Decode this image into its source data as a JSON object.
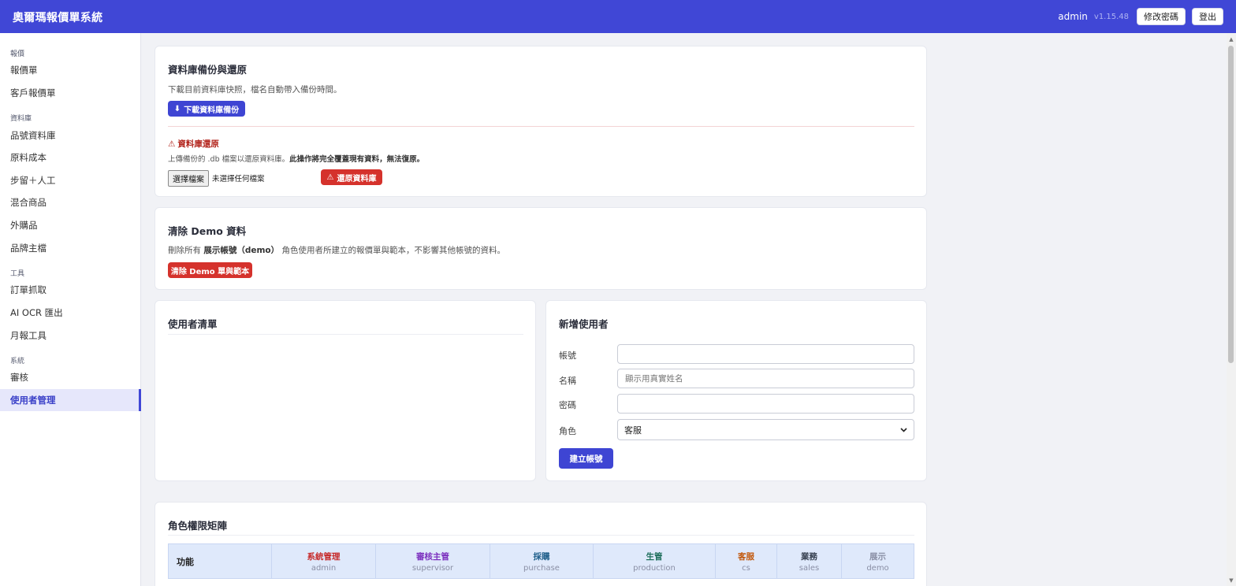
{
  "header": {
    "title": "奧爾瑪報價單系統",
    "user": "admin",
    "version": "v1.15.48",
    "change_password": "修改密碼",
    "logout": "登出"
  },
  "sidebar": {
    "sections": [
      {
        "label": "報價"
      },
      {
        "label": "資料庫"
      },
      {
        "label": "工具"
      },
      {
        "label": "系統"
      }
    ],
    "items": [
      {
        "label": "報價單"
      },
      {
        "label": "客戶報價單"
      },
      {
        "label": "品號資料庫"
      },
      {
        "label": "原料成本"
      },
      {
        "label": "步留＋人工"
      },
      {
        "label": "混合商品"
      },
      {
        "label": "外購品"
      },
      {
        "label": "品牌主檔"
      },
      {
        "label": "訂單抓取"
      },
      {
        "label": "AI OCR 匯出"
      },
      {
        "label": "月報工具"
      },
      {
        "label": "審核"
      },
      {
        "label": "使用者管理",
        "active": true
      }
    ]
  },
  "backup": {
    "title": "資料庫備份與還原",
    "description": "下載目前資料庫快照，檔名自動帶入備份時間。",
    "download_button": "下載資料庫備份",
    "restore_title": "資料庫還原",
    "restore_desc_prefix": "上傳備份的 .db 檔案以還原資料庫。",
    "restore_desc_warning": "此操作將完全覆蓋現有資料，無法復原。",
    "choose_file": "選擇檔案",
    "no_file": "未選擇任何檔案",
    "restore_button": "還原資料庫"
  },
  "demo": {
    "title": "清除 Demo 資料",
    "desc_prefix": "刪除所有",
    "desc_bold": "展示帳號（demo）",
    "desc_suffix": "角色使用者所建立的報價單與範本，不影響其他帳號的資料。",
    "button": "清除 Demo 單與範本"
  },
  "users": {
    "title": "使用者清單"
  },
  "new_user": {
    "title": "新增使用者",
    "account_label": "帳號",
    "name_label": "名稱",
    "name_placeholder": "顯示用真實姓名",
    "password_label": "密碼",
    "role_label": "角色",
    "role_value": "客服",
    "create_button": "建立帳號"
  },
  "matrix": {
    "title": "角色權限矩陣",
    "feature_header": "功能",
    "roles": [
      {
        "name": "系統管理",
        "code": "admin",
        "color": "#c62828"
      },
      {
        "name": "審核主管",
        "code": "supervisor",
        "color": "#7b2fbe"
      },
      {
        "name": "採購",
        "code": "purchase",
        "color": "#1f5f8b"
      },
      {
        "name": "生管",
        "code": "production",
        "color": "#1f6f5c"
      },
      {
        "name": "客服",
        "code": "cs",
        "color": "#c2580c"
      },
      {
        "name": "業務",
        "code": "sales",
        "color": "#374151"
      },
      {
        "name": "展示",
        "code": "demo",
        "color": "#8a8fa5"
      }
    ]
  }
}
